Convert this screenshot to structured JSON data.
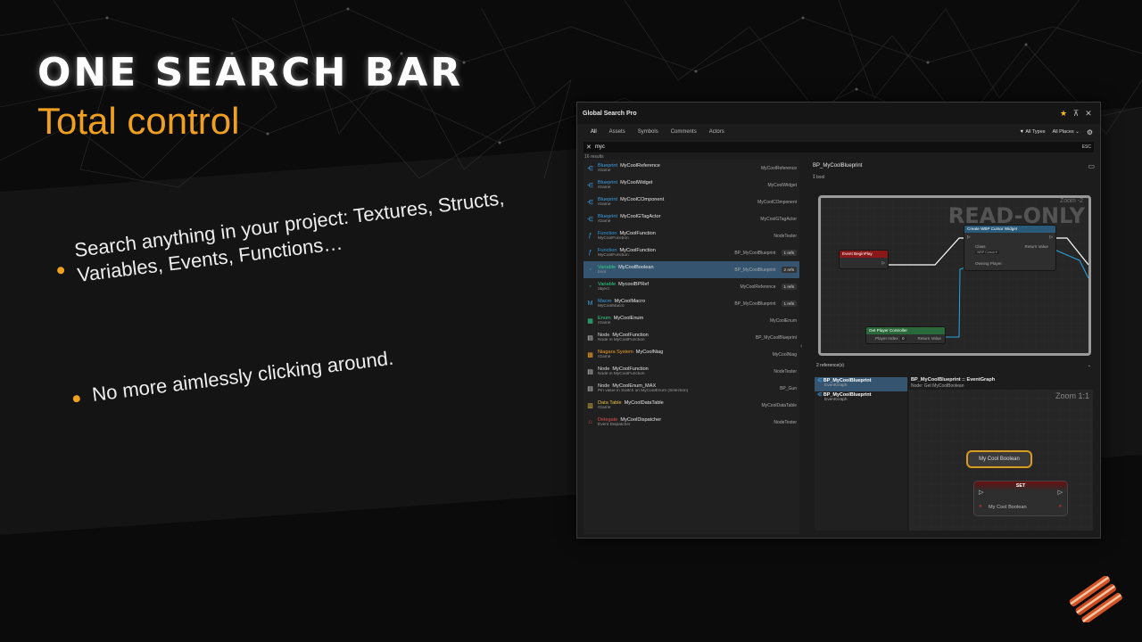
{
  "slide": {
    "title": "ONE SEARCH BAR",
    "subtitle": "Total control",
    "bullets": [
      "Search anything in your project: Textures, Structs, Variables, Events, Functions…",
      "No more aimlessly clicking around."
    ]
  },
  "window": {
    "title": "Global Search Pro",
    "tabs": [
      "All",
      "Assets",
      "Symbols",
      "Comments",
      "Actors"
    ],
    "active_tab": "All",
    "type_filter": "All Types",
    "place_filter": "All Places",
    "search_value": "myc",
    "esc_label": "ESC",
    "result_count": "16 results",
    "results": [
      {
        "kind": "Blueprint",
        "kind_class": "k-bp",
        "name": "MyCoolReference",
        "path": "/Game",
        "location": "MyCoolReference",
        "refs": "",
        "icon": "blueprint-icon",
        "icon_char": "⋲"
      },
      {
        "kind": "Blueprint",
        "kind_class": "k-bp",
        "name": "MyCoolWidget",
        "path": "/Game",
        "location": "MyCoolWidget",
        "refs": "",
        "icon": "blueprint-icon",
        "icon_char": "⋲"
      },
      {
        "kind": "Blueprint",
        "kind_class": "k-bp",
        "name": "MyCoolCOmponent",
        "path": "/Game",
        "location": "MyCoolCOmponent",
        "refs": "",
        "icon": "blueprint-icon",
        "icon_char": "⋲"
      },
      {
        "kind": "Blueprint",
        "kind_class": "k-bp",
        "name": "MyCoolGTagActor",
        "path": "/Game",
        "location": "MyCoolGTagActor",
        "refs": "",
        "icon": "blueprint-icon",
        "icon_char": "⋲"
      },
      {
        "kind": "Function",
        "kind_class": "k-fn",
        "name": "MyCoolFunction",
        "path": "MyCoolFunction",
        "location": "NodeTester",
        "refs": "",
        "icon": "function-icon",
        "icon_char": "ƒ"
      },
      {
        "kind": "Function",
        "kind_class": "k-fn",
        "name": "MyCoolFunction",
        "path": "MyCoolFunction",
        "location": "BP_MyCoolBlueprint",
        "refs": "1 refs",
        "icon": "function-icon",
        "icon_char": "ƒ"
      },
      {
        "kind": "Variable",
        "kind_class": "k-var",
        "name": "MyCoolBoolean",
        "path": "bool",
        "location": "BP_MyCoolBlueprint",
        "refs": "2 refs",
        "icon": "variable-icon",
        "icon_char": "◦"
      },
      {
        "kind": "Variable",
        "kind_class": "k-var",
        "name": "MycoolBPRef",
        "path": "object",
        "location": "MyCoolReference",
        "refs": "1 refs",
        "icon": "variable-icon",
        "icon_char": "◦"
      },
      {
        "kind": "Macro",
        "kind_class": "k-macro",
        "name": "MyCoolMacro",
        "path": "MyCoolMacro",
        "location": "BP_MyCoolBlueprint",
        "refs": "1 refs",
        "icon": "macro-icon",
        "icon_char": "M"
      },
      {
        "kind": "Enum",
        "kind_class": "k-enum",
        "name": "MyCoolEnum",
        "path": "/Game",
        "location": "MyCoolEnum",
        "refs": "",
        "icon": "enum-icon",
        "icon_char": "▦"
      },
      {
        "kind": "Node",
        "kind_class": "k-node",
        "name": "MyCoolFunction",
        "path": "Node in MyCoolFunction",
        "location": "BP_MyCoolBlueprint",
        "refs": "",
        "icon": "node-icon",
        "icon_char": "▤"
      },
      {
        "kind": "Niagara System",
        "kind_class": "k-niag",
        "name": "MyCoolNiag",
        "path": "/Game",
        "location": "MyCoolNiag",
        "refs": "",
        "icon": "niagara-icon",
        "icon_char": "▩"
      },
      {
        "kind": "Node",
        "kind_class": "k-node",
        "name": "MyCoolFunction",
        "path": "Node in MyCoolFunction",
        "location": "NodeTester",
        "refs": "",
        "icon": "node-icon",
        "icon_char": "▤"
      },
      {
        "kind": "Node",
        "kind_class": "k-node",
        "name": "MyCoolEnum_MAX",
        "path": "Pin value in Switch on MyCoolEnum (Selection)",
        "location": "BP_Gun",
        "refs": "",
        "icon": "node-icon",
        "icon_char": "▤"
      },
      {
        "kind": "Data Table",
        "kind_class": "k-dt",
        "name": "MyCoolDataTable",
        "path": "/Game",
        "location": "MyCoolDataTable",
        "refs": "",
        "icon": "datatable-icon",
        "icon_char": "▥"
      },
      {
        "kind": "Delegate",
        "kind_class": "k-del",
        "name": "MyCoolDispatcher",
        "path": "Event Dispatcher",
        "location": "NodeTester",
        "refs": "",
        "icon": "delegate-icon",
        "icon_char": "⌂"
      }
    ],
    "selected_result": 6,
    "details": {
      "name": "BP_MyCoolBlueprint",
      "type": "bool",
      "readonly": "READ-ONLY",
      "zoom": "Zoom -2",
      "nodes": {
        "event": "Event BeginPlay",
        "create": "Create WBP Cursor Widget",
        "class_pin": "Class",
        "class_value": "WBP Cursor ▾",
        "owning": "Owning Player",
        "return_value": "Return Value",
        "getpc": "Get Player Controller",
        "player_index": "Player Index",
        "pi_value": "0",
        "pc_return": "Return Value"
      }
    },
    "references": {
      "header": "2 reference(s)",
      "items": [
        {
          "name": "BP_MyCoolBlueprint",
          "graph": "EventGraph"
        },
        {
          "name": "BP_MyCoolBlueprint",
          "graph": "EventGraph"
        }
      ],
      "preview_title": "BP_MyCoolBlueprint :: EventGraph",
      "preview_sub": "Node: Get MyCoolBoolean",
      "preview_zoom": "Zoom 1:1",
      "var_node": "My Cool Boolean",
      "set_header": "SET",
      "set_label": "My Cool Boolean"
    }
  },
  "colors": {
    "accent": "#f0a020",
    "selection": "#345470",
    "variable": "#2fd18c",
    "blueprint": "#3fa0e6"
  }
}
